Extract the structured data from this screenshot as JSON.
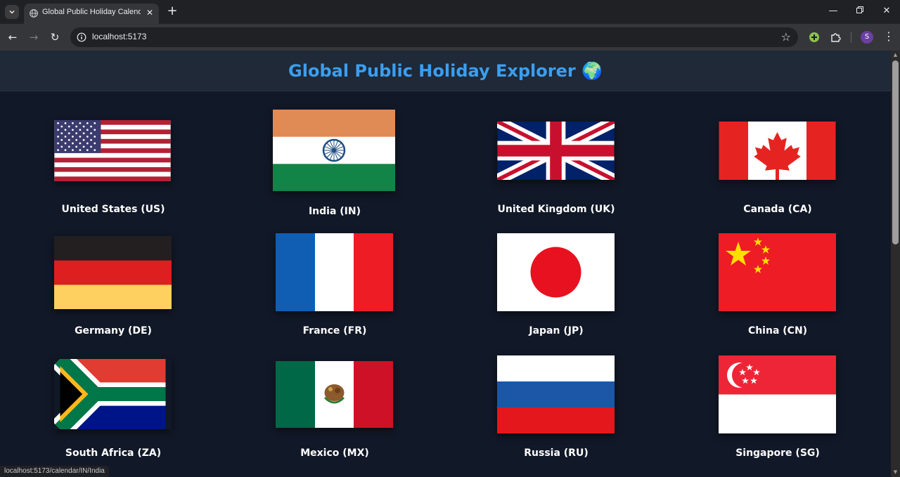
{
  "browser": {
    "tab_title": "Global Public Holiday Calendar",
    "url": "localhost:5173",
    "profile_initial": "S",
    "status_url": "localhost:5173/calendar/IN/India"
  },
  "page": {
    "title": "Global Public Holiday Explorer",
    "title_emoji": "🌍",
    "accent_color": "#3b9ef0"
  },
  "countries": [
    {
      "label": "United States (US)",
      "flag": "us-flag"
    },
    {
      "label": "India (IN)",
      "flag": "india-flag"
    },
    {
      "label": "United Kingdom (UK)",
      "flag": "uk-flag"
    },
    {
      "label": "Canada (CA)",
      "flag": "canada-flag"
    },
    {
      "label": "Germany (DE)",
      "flag": "germany-flag"
    },
    {
      "label": "France (FR)",
      "flag": "france-flag"
    },
    {
      "label": "Japan (JP)",
      "flag": "japan-flag"
    },
    {
      "label": "China (CN)",
      "flag": "china-flag"
    },
    {
      "label": "South Africa (ZA)",
      "flag": "south-africa-flag"
    },
    {
      "label": "Mexico (MX)",
      "flag": "mexico-flag"
    },
    {
      "label": "Russia (RU)",
      "flag": "russia-flag"
    },
    {
      "label": "Singapore (SG)",
      "flag": "singapore-flag"
    }
  ]
}
